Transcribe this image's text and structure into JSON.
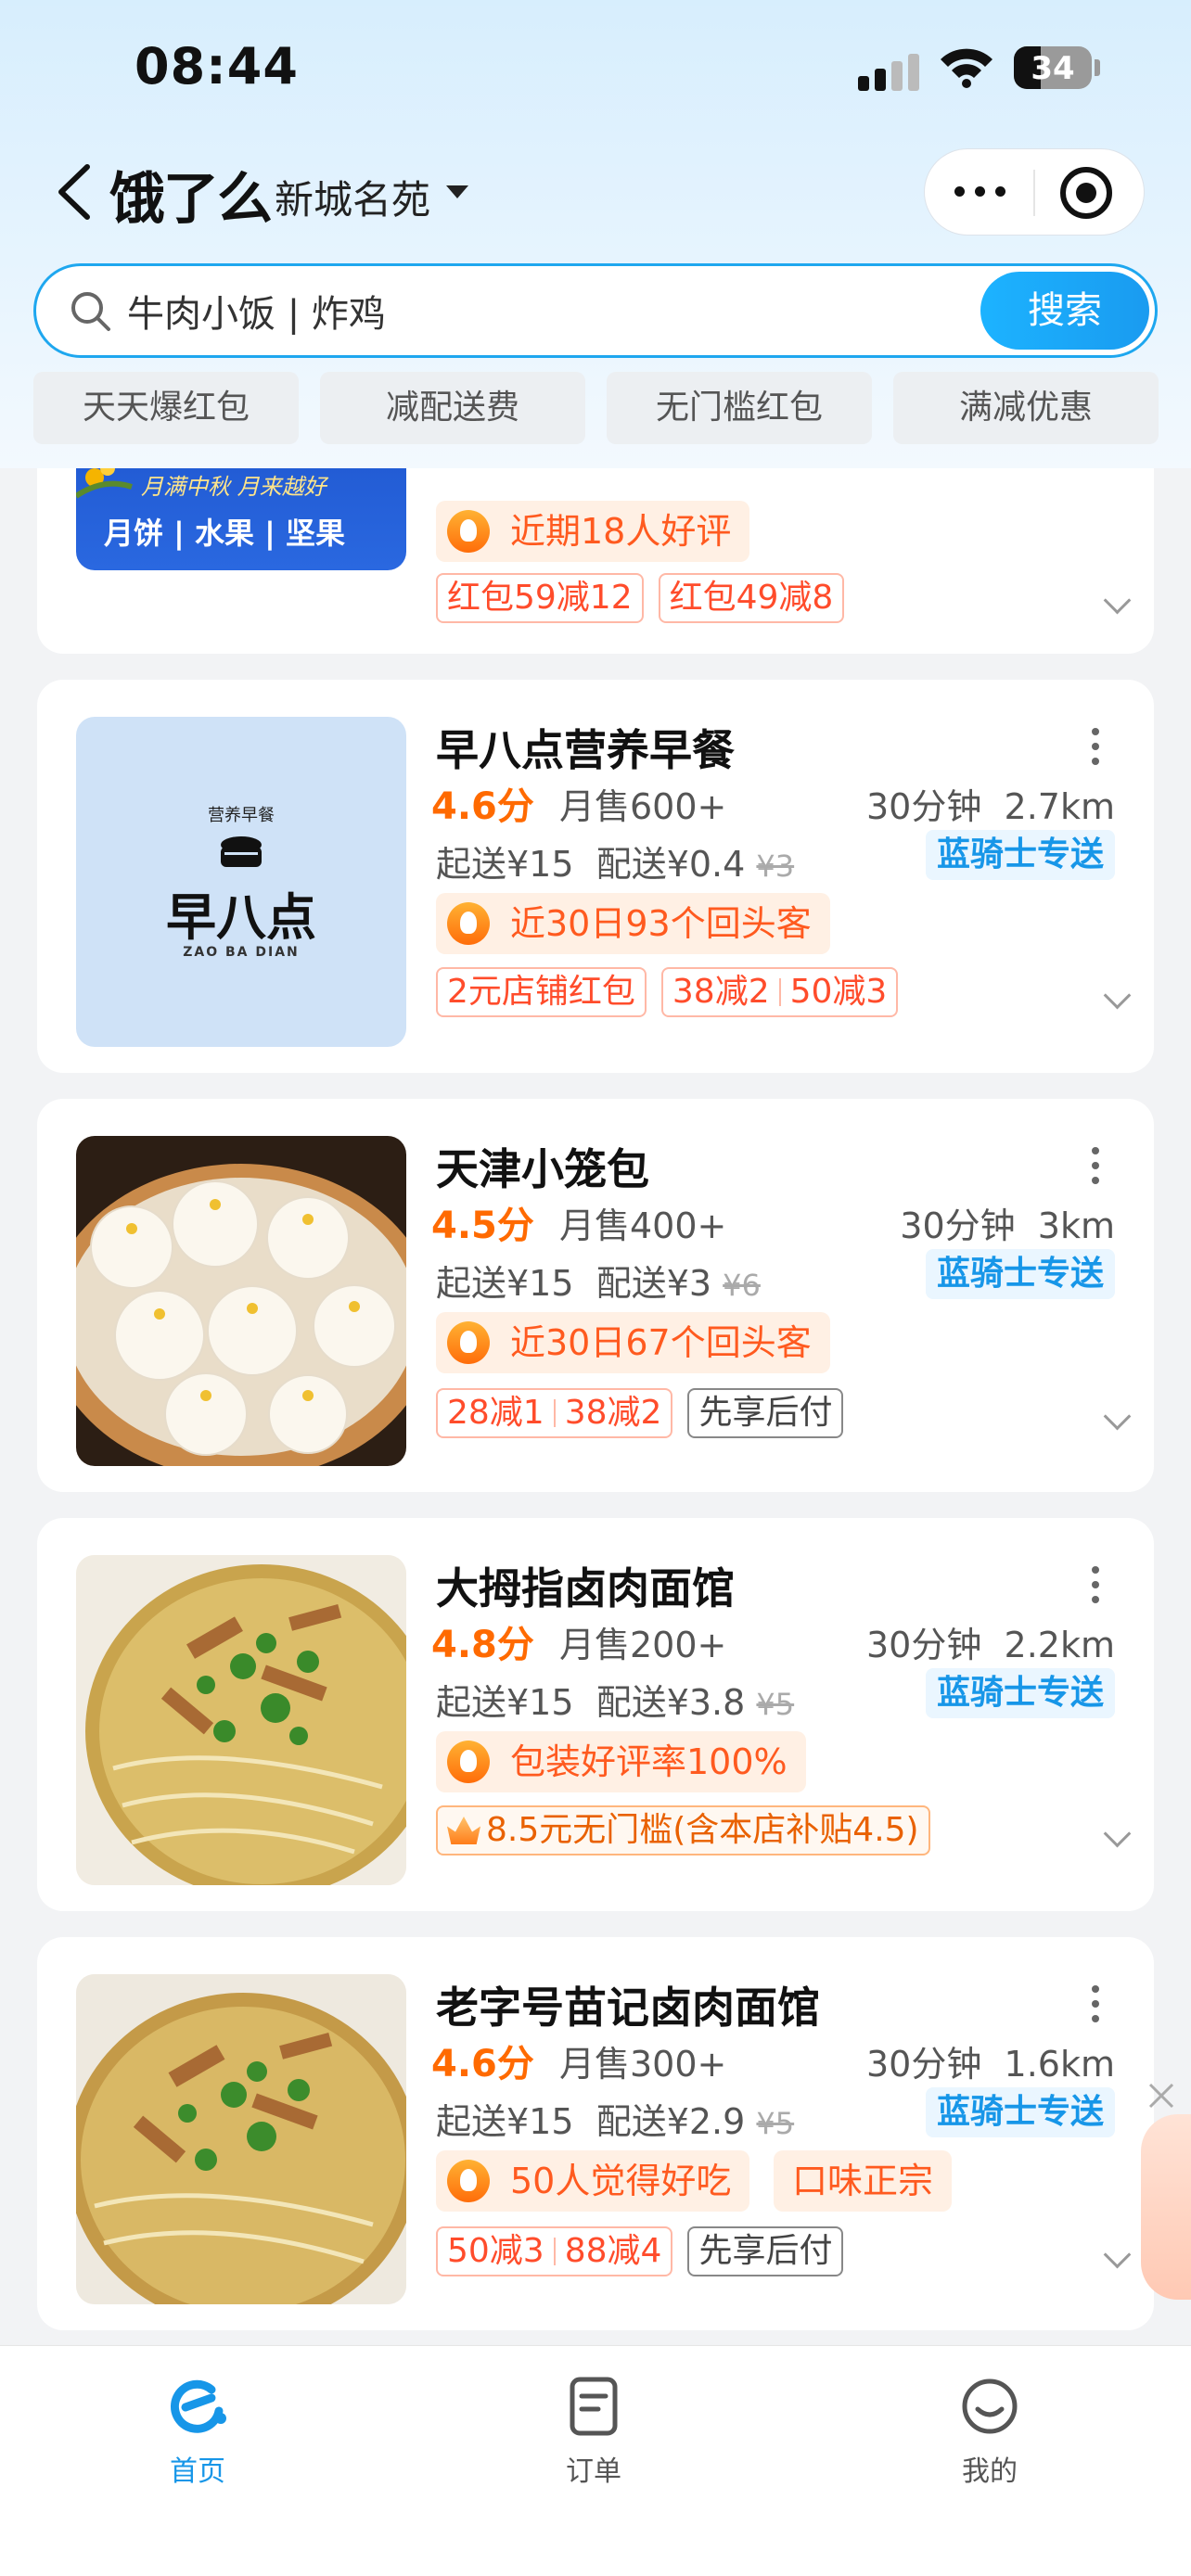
{
  "status_bar": {
    "time": "08:44",
    "battery": "34",
    "battery_level": 0.34
  },
  "header": {
    "logo": "饿了么",
    "address": "新城名苑"
  },
  "search": {
    "value": "牛肉小饭 | 炸鸡",
    "button": "搜索"
  },
  "chips": [
    "天天爆红包",
    "减配送费",
    "无门槛红包",
    "满减优惠"
  ],
  "partial_card": {
    "banner_text": "月饼 | 水果 | 坚果",
    "banner_script": "月满中秋 月来越好",
    "highlight": "近期18人好评",
    "tags": [
      "红包59减12",
      "红包49减8"
    ]
  },
  "shops": [
    {
      "name": "早八点营养早餐",
      "rating": "4.6分",
      "sales": "月售600+",
      "time": "30分钟",
      "distance": "2.7km",
      "min_order": "起送¥15",
      "delivery": "配送¥0.4",
      "orig_delivery": "¥3",
      "rider": "蓝骑士专送",
      "highlight": "近30日93个回头客",
      "tags": [
        [
          "2元店铺红包"
        ],
        [
          "38减2",
          "50减3"
        ]
      ],
      "logo": {
        "top": "营养早餐",
        "main": "早八点",
        "sub": "ZAO BA DIAN"
      }
    },
    {
      "name": "天津小笼包",
      "rating": "4.5分",
      "sales": "月售400+",
      "time": "30分钟",
      "distance": "3km",
      "min_order": "起送¥15",
      "delivery": "配送¥3",
      "orig_delivery": "¥6",
      "rider": "蓝骑士专送",
      "highlight": "近30日67个回头客",
      "tags": [
        [
          "28减1",
          "38减2"
        ],
        [
          "先享后付"
        ]
      ]
    },
    {
      "name": "大拇指卤肉面馆",
      "rating": "4.8分",
      "sales": "月售200+",
      "time": "30分钟",
      "distance": "2.2km",
      "min_order": "起送¥15",
      "delivery": "配送¥3.8",
      "orig_delivery": "¥5",
      "rider": "蓝骑士专送",
      "highlight": "包装好评率100%",
      "tags": [
        [
          "8.5元无门槛(含本店补贴4.5)"
        ]
      ]
    },
    {
      "name": "老字号苗记卤肉面馆",
      "rating": "4.6分",
      "sales": "月售300+",
      "time": "30分钟",
      "distance": "1.6km",
      "min_order": "起送¥15",
      "delivery": "配送¥2.9",
      "orig_delivery": "¥5",
      "rider": "蓝骑士专送",
      "highlight": "50人觉得好吃",
      "highlight2": "口味正宗",
      "tags": [
        [
          "50减3",
          "88减4"
        ],
        [
          "先享后付"
        ]
      ]
    }
  ],
  "tabbar": [
    {
      "label": "首页"
    },
    {
      "label": "订单"
    },
    {
      "label": "我的"
    }
  ],
  "colors": {
    "accent": "#1796e8",
    "price_orange": "#ff6a00",
    "tag_red": "#ff4c2b"
  }
}
